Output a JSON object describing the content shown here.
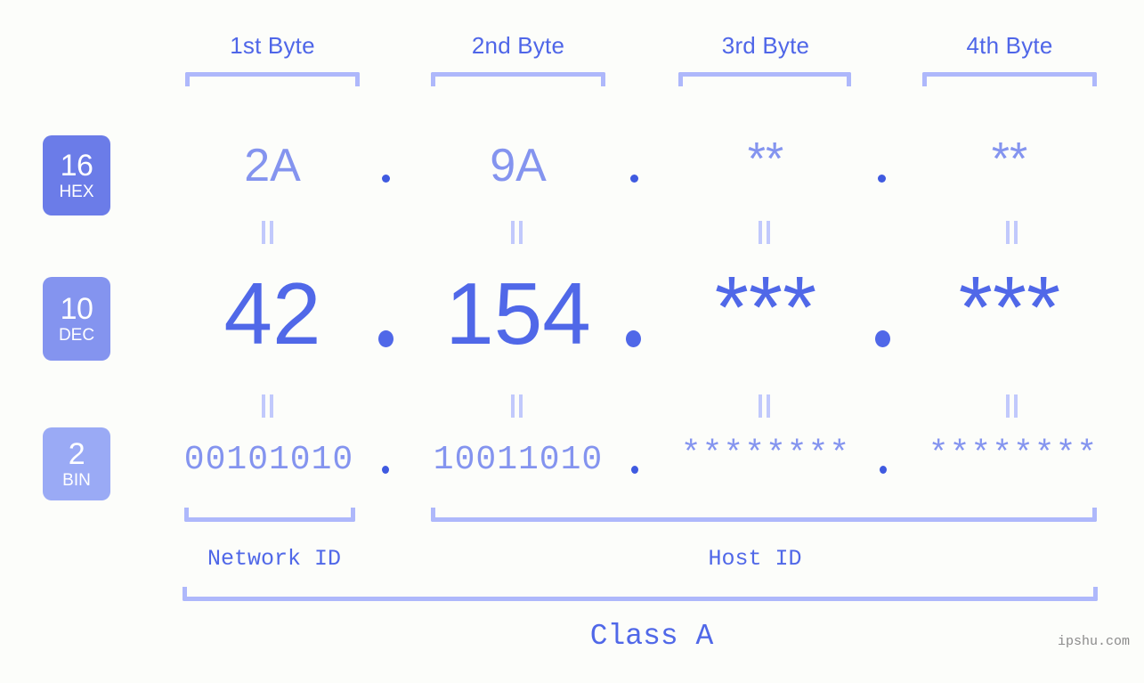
{
  "page": {
    "background": "#fcfdfa",
    "accent": "#5068e8",
    "accent_light": "#8494ef",
    "bracket_color": "#aeb8fb",
    "watermark": "ipshu.com"
  },
  "byte_headers": [
    {
      "label": "1st Byte"
    },
    {
      "label": "2nd Byte"
    },
    {
      "label": "3rd Byte"
    },
    {
      "label": "4th Byte"
    }
  ],
  "bases": [
    {
      "id": "hex",
      "radix": "16",
      "abbr": "HEX",
      "color": "#6b7ce8"
    },
    {
      "id": "dec",
      "radix": "10",
      "abbr": "DEC",
      "color": "#8494ef"
    },
    {
      "id": "bin",
      "radix": "2",
      "abbr": "BIN",
      "color": "#9aaaf5"
    }
  ],
  "rows": {
    "hex": {
      "values": [
        "2A",
        "9A",
        "**",
        "**"
      ],
      "separator": "."
    },
    "dec": {
      "values": [
        "42",
        "154",
        "***",
        "***"
      ],
      "separator": "."
    },
    "bin": {
      "values": [
        "00101010",
        "10011010",
        "********",
        "********"
      ],
      "separator": "."
    }
  },
  "segments": {
    "network_id": "Network ID",
    "host_id": "Host ID",
    "class": "Class A"
  },
  "equals_marks": {
    "symbol": "||",
    "count_per_row": 4
  }
}
